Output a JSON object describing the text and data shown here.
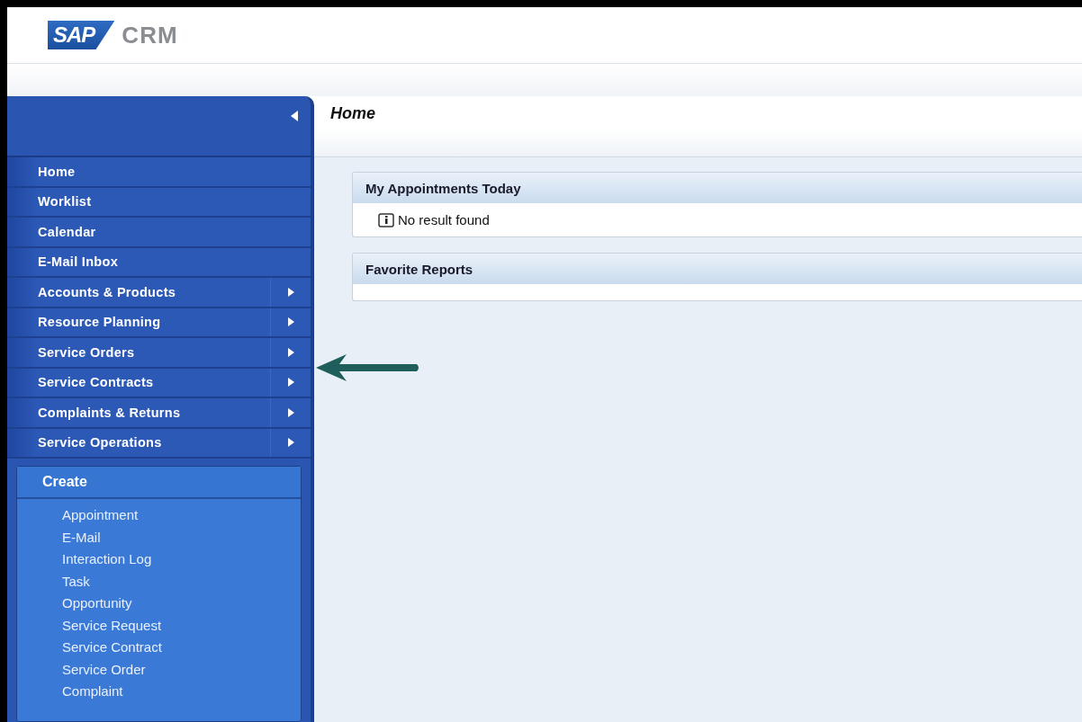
{
  "logo": {
    "mark": "SAP",
    "product": "CRM"
  },
  "page_title": "Home",
  "nav": [
    {
      "label": "Home",
      "submenu": false
    },
    {
      "label": "Worklist",
      "submenu": false
    },
    {
      "label": "Calendar",
      "submenu": false
    },
    {
      "label": "E-Mail Inbox",
      "submenu": false
    },
    {
      "label": "Accounts & Products",
      "submenu": true
    },
    {
      "label": "Resource Planning",
      "submenu": true
    },
    {
      "label": "Service Orders",
      "submenu": true
    },
    {
      "label": "Service Contracts",
      "submenu": true
    },
    {
      "label": "Complaints & Returns",
      "submenu": true
    },
    {
      "label": "Service Operations",
      "submenu": true
    }
  ],
  "create": {
    "title": "Create",
    "items": [
      "Appointment",
      "E-Mail",
      "Interaction Log",
      "Task",
      "Opportunity",
      "Service Request",
      "Service Contract",
      "Service Order",
      "Complaint"
    ]
  },
  "panels": [
    {
      "title": "My Appointments Today",
      "message": "No result found"
    },
    {
      "title": "Favorite Reports"
    }
  ]
}
